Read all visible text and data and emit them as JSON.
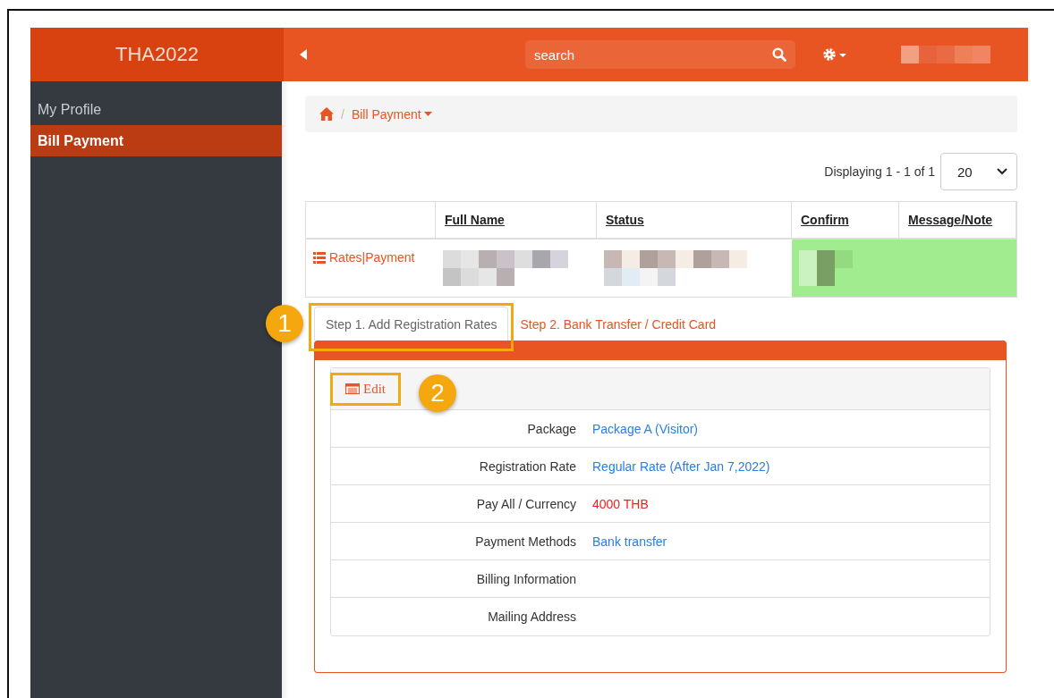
{
  "brand": "THA2022",
  "search": {
    "placeholder": "search"
  },
  "sidebar": {
    "items": [
      {
        "label": "My Profile",
        "selected": false
      },
      {
        "label": "Bill Payment",
        "selected": true
      }
    ]
  },
  "breadcrumb": {
    "separator": "/",
    "current": "Bill Payment"
  },
  "pager": {
    "text": "Displaying 1 - 1 of 1",
    "page_size": "20"
  },
  "table": {
    "columns": [
      "Full Name",
      "Status",
      "Confirm",
      "Message/Note"
    ],
    "rows": [
      {
        "action": "Rates|Payment",
        "confirmed": true
      }
    ]
  },
  "tabs": [
    {
      "label": "Step 1. Add Registration Rates",
      "selected": true,
      "callout": "1"
    },
    {
      "label": "Step 2. Bank Transfer / Credit Card",
      "selected": false
    }
  ],
  "edit_button": {
    "label": "Edit",
    "callout": "2"
  },
  "details": [
    {
      "label": "Package",
      "value": "Package A (Visitor)",
      "kind": "link"
    },
    {
      "label": "Registration Rate",
      "value": "Regular Rate (After Jan 7,2022)",
      "kind": "link"
    },
    {
      "label": "Pay All / Currency",
      "value": "4000 THB",
      "kind": "amount"
    },
    {
      "label": "Payment Methods",
      "value": "Bank transfer",
      "kind": "link"
    },
    {
      "label": "Billing Information"
    },
    {
      "label": "Mailing Address"
    }
  ]
}
